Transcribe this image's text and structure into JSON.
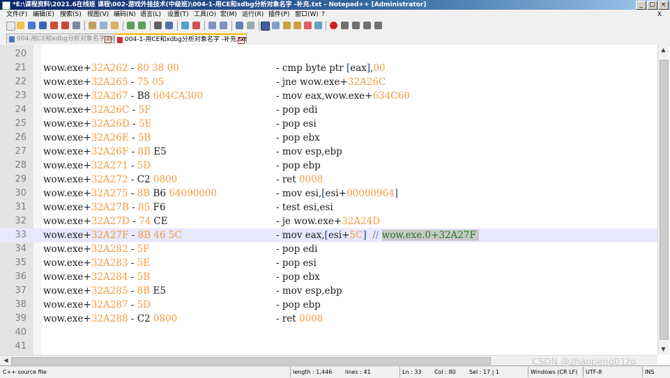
{
  "window": {
    "title": "*E:\\课程资料\\2021.6在线班 课程\\002-游戏外挂技术(中级班)\\004-1-用CE和xdbg分析对象名字 -补充.txt - Notepad++ [Administrator]",
    "buttons": [
      "_",
      "□",
      "×"
    ]
  },
  "menu": {
    "items": [
      "文件(F)",
      "编辑(E)",
      "搜索(S)",
      "视图(V)",
      "编码(N)",
      "语言(L)",
      "设置(T)",
      "工具(O)",
      "宏(M)",
      "运行(R)",
      "插件(P)",
      "窗口(W)",
      "?"
    ],
    "close": "X"
  },
  "tabs": [
    {
      "label": "004-用CE和xdbg分析对象名字.txt",
      "close": "×"
    },
    {
      "label": "004-1-用CE和xdbg分析对象名字 -补充.txt",
      "close": "×"
    }
  ],
  "editor": {
    "lines": [
      {
        "n": "20",
        "addr": [],
        "instr": []
      },
      {
        "n": "21",
        "addr": [
          [
            "k",
            "wow.exe+"
          ],
          [
            "o",
            "32A262"
          ],
          [
            "k",
            " - "
          ],
          [
            "o",
            "80 38 00"
          ]
        ],
        "instr": [
          [
            "k",
            "- cmp byte ptr "
          ],
          [
            "b",
            "["
          ],
          [
            "k",
            "eax"
          ],
          [
            "b",
            "]"
          ],
          [
            "k",
            ","
          ],
          [
            "o",
            "00"
          ]
        ]
      },
      {
        "n": "22",
        "addr": [
          [
            "k",
            "wow.exe+"
          ],
          [
            "o",
            "32A265"
          ],
          [
            "k",
            " - "
          ],
          [
            "o",
            "75 05"
          ]
        ],
        "instr": [
          [
            "k",
            "- jne wow.exe+"
          ],
          [
            "o",
            "32A26C"
          ]
        ]
      },
      {
        "n": "23",
        "addr": [
          [
            "k",
            "wow.exe+"
          ],
          [
            "o",
            "32A267"
          ],
          [
            "k",
            " - B8 "
          ],
          [
            "o",
            "604CA300"
          ]
        ],
        "instr": [
          [
            "k",
            "- mov eax,wow.exe+"
          ],
          [
            "o",
            "634C60"
          ]
        ]
      },
      {
        "n": "24",
        "addr": [
          [
            "k",
            "wow.exe+"
          ],
          [
            "o",
            "32A26C"
          ],
          [
            "k",
            " - "
          ],
          [
            "o",
            "5F"
          ]
        ],
        "instr": [
          [
            "k",
            "- pop edi"
          ]
        ]
      },
      {
        "n": "25",
        "addr": [
          [
            "k",
            "wow.exe+"
          ],
          [
            "o",
            "32A26D"
          ],
          [
            "k",
            " - "
          ],
          [
            "o",
            "5E"
          ]
        ],
        "instr": [
          [
            "k",
            "- pop esi"
          ]
        ]
      },
      {
        "n": "26",
        "addr": [
          [
            "k",
            "wow.exe+"
          ],
          [
            "o",
            "32A26E"
          ],
          [
            "k",
            " - "
          ],
          [
            "o",
            "5B"
          ]
        ],
        "instr": [
          [
            "k",
            "- pop ebx"
          ]
        ]
      },
      {
        "n": "27",
        "addr": [
          [
            "k",
            "wow.exe+"
          ],
          [
            "o",
            "32A26F"
          ],
          [
            "k",
            " - "
          ],
          [
            "o",
            "8B"
          ],
          [
            "k",
            " E5"
          ]
        ],
        "instr": [
          [
            "k",
            "- mov esp,ebp"
          ]
        ]
      },
      {
        "n": "28",
        "addr": [
          [
            "k",
            "wow.exe+"
          ],
          [
            "o",
            "32A271"
          ],
          [
            "k",
            " - "
          ],
          [
            "o",
            "5D"
          ]
        ],
        "instr": [
          [
            "k",
            "- pop ebp"
          ]
        ]
      },
      {
        "n": "29",
        "addr": [
          [
            "k",
            "wow.exe+"
          ],
          [
            "o",
            "32A272"
          ],
          [
            "k",
            " - C2 "
          ],
          [
            "o",
            "0800"
          ]
        ],
        "instr": [
          [
            "k",
            "- ret "
          ],
          [
            "o",
            "0008"
          ]
        ]
      },
      {
        "n": "30",
        "addr": [
          [
            "k",
            "wow.exe+"
          ],
          [
            "o",
            "32A275"
          ],
          [
            "k",
            " - "
          ],
          [
            "o",
            "8B"
          ],
          [
            "k",
            " B6 "
          ],
          [
            "o",
            "64090000"
          ]
        ],
        "instr": [
          [
            "k",
            "- mov esi,"
          ],
          [
            "b",
            "["
          ],
          [
            "k",
            "esi+"
          ],
          [
            "o",
            "00000964"
          ],
          [
            "b",
            "]"
          ]
        ]
      },
      {
        "n": "31",
        "addr": [
          [
            "k",
            "wow.exe+"
          ],
          [
            "o",
            "32A27B"
          ],
          [
            "k",
            " - "
          ],
          [
            "o",
            "85"
          ],
          [
            "k",
            " F6"
          ]
        ],
        "instr": [
          [
            "k",
            "- test esi,esi"
          ]
        ]
      },
      {
        "n": "32",
        "addr": [
          [
            "k",
            "wow.exe+"
          ],
          [
            "o",
            "32A27D"
          ],
          [
            "k",
            " - "
          ],
          [
            "o",
            "74"
          ],
          [
            "k",
            " CE"
          ]
        ],
        "instr": [
          [
            "k",
            "- je wow.exe+"
          ],
          [
            "o",
            "32A24D"
          ]
        ]
      },
      {
        "n": "33",
        "current": true,
        "addr": [
          [
            "k",
            "wow.exe+"
          ],
          [
            "o",
            "32A27F"
          ],
          [
            "k",
            " - "
          ],
          [
            "o",
            "8B 46 5C"
          ]
        ],
        "instr": [
          [
            "k",
            "- mov eax,"
          ],
          [
            "b",
            "["
          ],
          [
            "k",
            "esi+"
          ],
          [
            "o",
            "5C"
          ],
          [
            "b",
            "]"
          ],
          [
            "k",
            "  "
          ],
          [
            "g",
            "// "
          ],
          [
            "sel",
            "wow.exe.0+32A27F "
          ]
        ]
      },
      {
        "n": "34",
        "addr": [
          [
            "k",
            "wow.exe+"
          ],
          [
            "o",
            "32A282"
          ],
          [
            "k",
            " - "
          ],
          [
            "o",
            "5F"
          ]
        ],
        "instr": [
          [
            "k",
            "- pop edi"
          ]
        ]
      },
      {
        "n": "35",
        "addr": [
          [
            "k",
            "wow.exe+"
          ],
          [
            "o",
            "32A283"
          ],
          [
            "k",
            " - "
          ],
          [
            "o",
            "5E"
          ]
        ],
        "instr": [
          [
            "k",
            "- pop esi"
          ]
        ]
      },
      {
        "n": "36",
        "addr": [
          [
            "k",
            "wow.exe+"
          ],
          [
            "o",
            "32A284"
          ],
          [
            "k",
            " - "
          ],
          [
            "o",
            "5B"
          ]
        ],
        "instr": [
          [
            "k",
            "- pop ebx"
          ]
        ]
      },
      {
        "n": "37",
        "addr": [
          [
            "k",
            "wow.exe+"
          ],
          [
            "o",
            "32A285"
          ],
          [
            "k",
            " - "
          ],
          [
            "o",
            "8B"
          ],
          [
            "k",
            " E5"
          ]
        ],
        "instr": [
          [
            "k",
            "- mov esp,ebp"
          ]
        ]
      },
      {
        "n": "38",
        "addr": [
          [
            "k",
            "wow.exe+"
          ],
          [
            "o",
            "32A287"
          ],
          [
            "k",
            " - "
          ],
          [
            "o",
            "5D"
          ]
        ],
        "instr": [
          [
            "k",
            "- pop ebp"
          ]
        ]
      },
      {
        "n": "39",
        "addr": [
          [
            "k",
            "wow.exe+"
          ],
          [
            "o",
            "32A288"
          ],
          [
            "k",
            " - C2 "
          ],
          [
            "o",
            "0800"
          ]
        ],
        "instr": [
          [
            "k",
            "- ret "
          ],
          [
            "o",
            "0008"
          ]
        ]
      },
      {
        "n": "40",
        "addr": [],
        "instr": []
      },
      {
        "n": "41",
        "addr": [],
        "instr": []
      }
    ]
  },
  "status": {
    "file_type": "C++ source file",
    "length": "length : 1,446",
    "lines": "lines : 41",
    "ln": "Ln : 33",
    "col": "Col : 80",
    "sel": "Sel : 17 | 1",
    "eol": "Windows (CR LF)",
    "encoding": "UTF-8",
    "mode": "INS"
  },
  "watermark": "CSDN @zhaopeng01zp",
  "colors": {
    "number": "#f59a3c",
    "bracket": "#1a3aa0",
    "selection_text": "#1e7a1e",
    "current_line": "#e8e8ff"
  }
}
